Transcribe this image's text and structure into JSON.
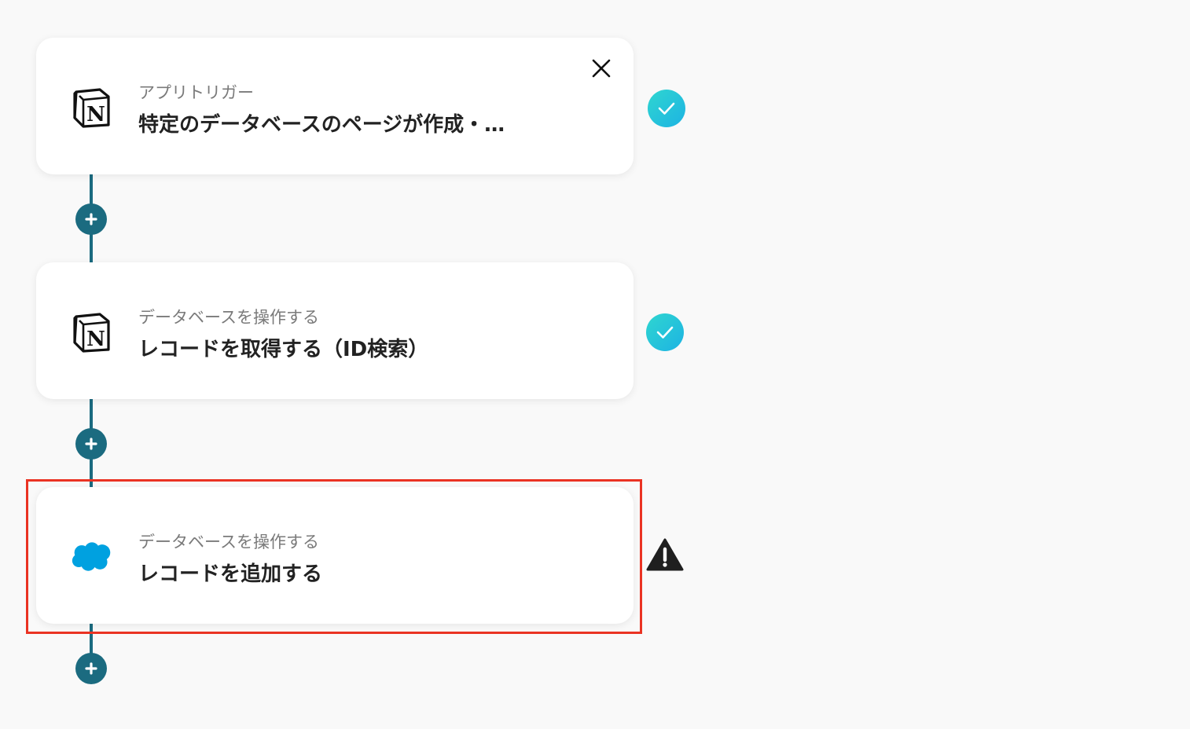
{
  "steps": [
    {
      "app": "Notion",
      "subtitle": "アプリトリガー",
      "title": "特定のデータベースのページが作成・…",
      "status": "complete"
    },
    {
      "app": "Notion",
      "subtitle": "データベースを操作する",
      "title": "レコードを取得する（ID検索）",
      "status": "complete"
    },
    {
      "app": "Salesforce",
      "subtitle": "データベースを操作する",
      "title": "レコードを追加する",
      "status": "warning"
    }
  ],
  "icons": {
    "close": "close-icon",
    "add": "plus-icon",
    "complete": "check-icon",
    "warning": "warning-icon"
  },
  "colors": {
    "connector": "#1b6b80",
    "check_gradient_start": "#2fd6d0",
    "check_gradient_end": "#1db3e3",
    "highlight": "#ea3323",
    "warning": "#1f1f1f"
  }
}
